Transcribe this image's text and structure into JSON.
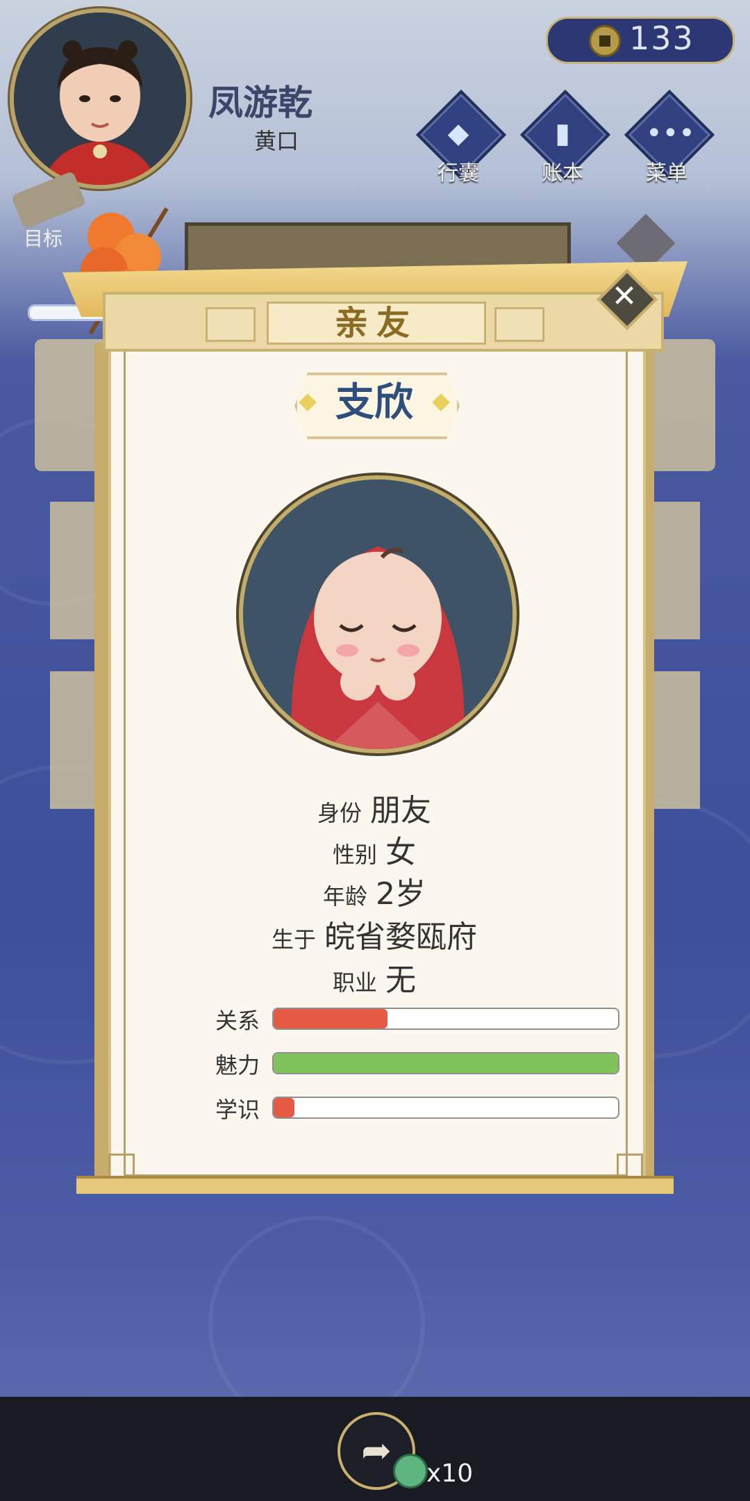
{
  "header": {
    "player_name": "凤游乾",
    "player_rank": "黄口",
    "coins": "133",
    "nav": [
      {
        "label": "行囊",
        "icon": "bag-icon"
      },
      {
        "label": "账本",
        "icon": "ledger-icon"
      },
      {
        "label": "菜单",
        "icon": "menu-dots-icon"
      }
    ],
    "goal_label": "目标"
  },
  "dialog": {
    "title": "亲友",
    "person_name": "支欣",
    "info": [
      {
        "key": "身份",
        "value": "朋友"
      },
      {
        "key": "性别",
        "value": "女"
      },
      {
        "key": "年龄",
        "value": "2岁"
      },
      {
        "key": "生于",
        "value": "皖省婺瓯府"
      },
      {
        "key": "职业",
        "value": "无"
      }
    ],
    "stats": [
      {
        "label": "关系",
        "fraction": 0.33,
        "color": "#e35a45"
      },
      {
        "label": "魅力",
        "fraction": 1.0,
        "color": "#7ec45a"
      },
      {
        "label": "学识",
        "fraction": 0.06,
        "color": "#e35a45"
      }
    ]
  },
  "share": {
    "count_label": "x10"
  }
}
